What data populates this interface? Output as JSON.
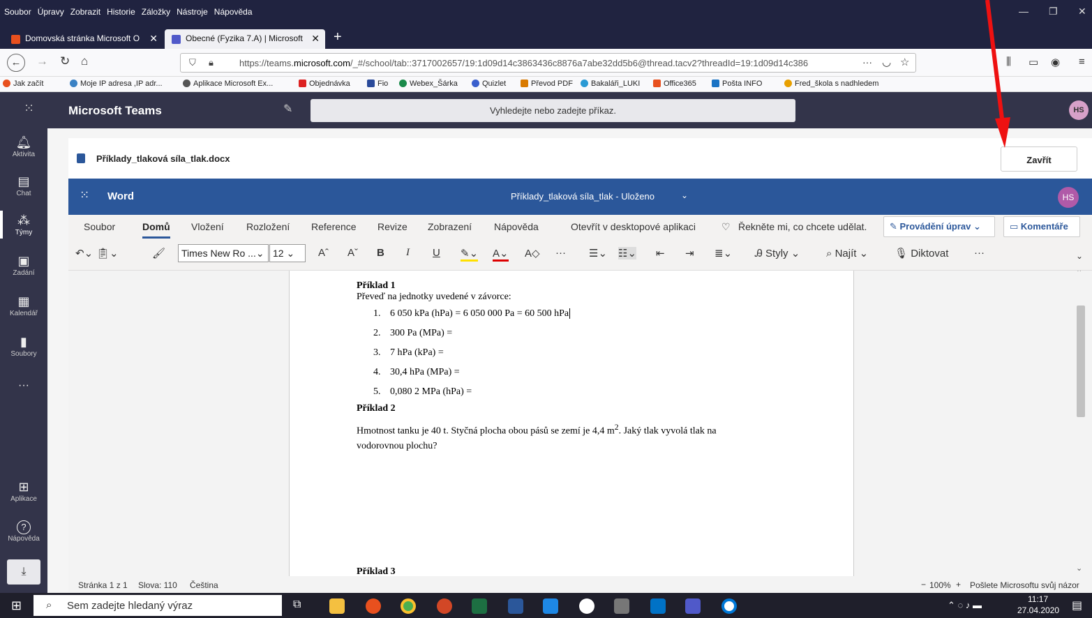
{
  "firefox": {
    "menu": [
      "Soubor",
      "Úpravy",
      "Zobrazit",
      "Historie",
      "Záložky",
      "Nástroje",
      "Nápověda"
    ],
    "tabs": [
      {
        "label": "Domovská stránka Microsoft O",
        "active": false,
        "color": "#e8501e"
      },
      {
        "label": "Obecné (Fyzika 7.A) | Microsoft",
        "active": true,
        "color": "#5059c9"
      }
    ],
    "url_prefix": "https://teams.",
    "url_host": "microsoft.com",
    "url_rest": "/_#/school/tab::3717002657/19:1d09d14c3863436c8876a7abe32dd5b6@thread.tacv2?threadId=19:1d09d14c386",
    "url_more": "···",
    "bookmarks": [
      {
        "label": "Jak začít",
        "color": "#e8501e"
      },
      {
        "label": "Moje IP adresa ,IP adr...",
        "color": "#3b82c4"
      },
      {
        "label": "Aplikace Microsoft Ex...",
        "color": "#555"
      },
      {
        "label": "Objednávka",
        "color": "#d22"
      },
      {
        "label": "Fio",
        "color": "#2a4a9a"
      },
      {
        "label": "Webex_Šárka",
        "color": "#1a8a4a"
      },
      {
        "label": "Quizlet",
        "color": "#3a5fcd"
      },
      {
        "label": "Převod PDF",
        "color": "#d97a00"
      },
      {
        "label": "Bakaláři_LUKI",
        "color": "#2a9ad4"
      },
      {
        "label": "Office365",
        "color": "#e8501e"
      },
      {
        "label": "Pošta INFO",
        "color": "#1a73c4"
      },
      {
        "label": "Fred_škola s nadhledem",
        "color": "#e8a000"
      }
    ]
  },
  "teams": {
    "app_title": "Microsoft Teams",
    "search_placeholder": "Vyhledejte nebo zadejte příkaz.",
    "avatar": "HS",
    "rail": [
      {
        "label": "Aktivita",
        "glyph": "🔔"
      },
      {
        "label": "Chat",
        "glyph": "▤"
      },
      {
        "label": "Týmy",
        "glyph": "⁂"
      },
      {
        "label": "Zadání",
        "glyph": "▣"
      },
      {
        "label": "Kalendář",
        "glyph": "▦"
      },
      {
        "label": "Soubory",
        "glyph": "▮"
      },
      {
        "label": "···",
        "glyph": ""
      },
      {
        "label": "Aplikace",
        "glyph": "⊞"
      },
      {
        "label": "Nápověda",
        "glyph": "?"
      }
    ],
    "file_name": "Příklady_tlaková síla_tlak.docx",
    "close_label": "Zavřít"
  },
  "word": {
    "app": "Word",
    "doc_title": "Příklady_tlaková síla_tlak  -  Uloženo",
    "avatar": "HS",
    "tabs": [
      "Soubor",
      "Domů",
      "Vložení",
      "Rozložení",
      "Reference",
      "Revize",
      "Zobrazení",
      "Nápověda",
      "Otevřít v desktopové aplikaci"
    ],
    "tell_me": "Řekněte mi, co chcete udělat.",
    "editing": "Provádění úprav",
    "comments": "Komentáře",
    "font": "Times New Ro ...",
    "size": "12",
    "styles": "Styly",
    "find": "Najít",
    "dictate": "Diktovat"
  },
  "document": {
    "h1": "Příklad 1",
    "intro": "Převeď na jednotky uvedené v závorce:",
    "items": [
      "6 050 kPa (hPa) = 6 050 000 Pa = 60 500 hPa",
      "300 Pa (MPa) =",
      "7 hPa (kPa) =",
      "30,4 hPa (MPa) =",
      "0,080 2 MPa (hPa) ="
    ],
    "h2": "Příklad 2",
    "p2a": "Hmotnost tanku je 40 t. Styčná plocha obou pásů se zemí je 4,4 m",
    "p2sup": "2",
    "p2b": ". Jaký tlak vyvolá tlak na",
    "p2c": "vodorovnou plochu?",
    "h3": "Příklad 3"
  },
  "status": {
    "page": "Stránka 1 z 1",
    "words": "Slova: 110",
    "lang": "Čeština",
    "zoom": "100%",
    "feedback": "Pošlete Microsoftu svůj názor"
  },
  "taskbar": {
    "search": "Sem zadejte hledaný výraz",
    "time": "11:17",
    "date": "27.04.2020"
  }
}
